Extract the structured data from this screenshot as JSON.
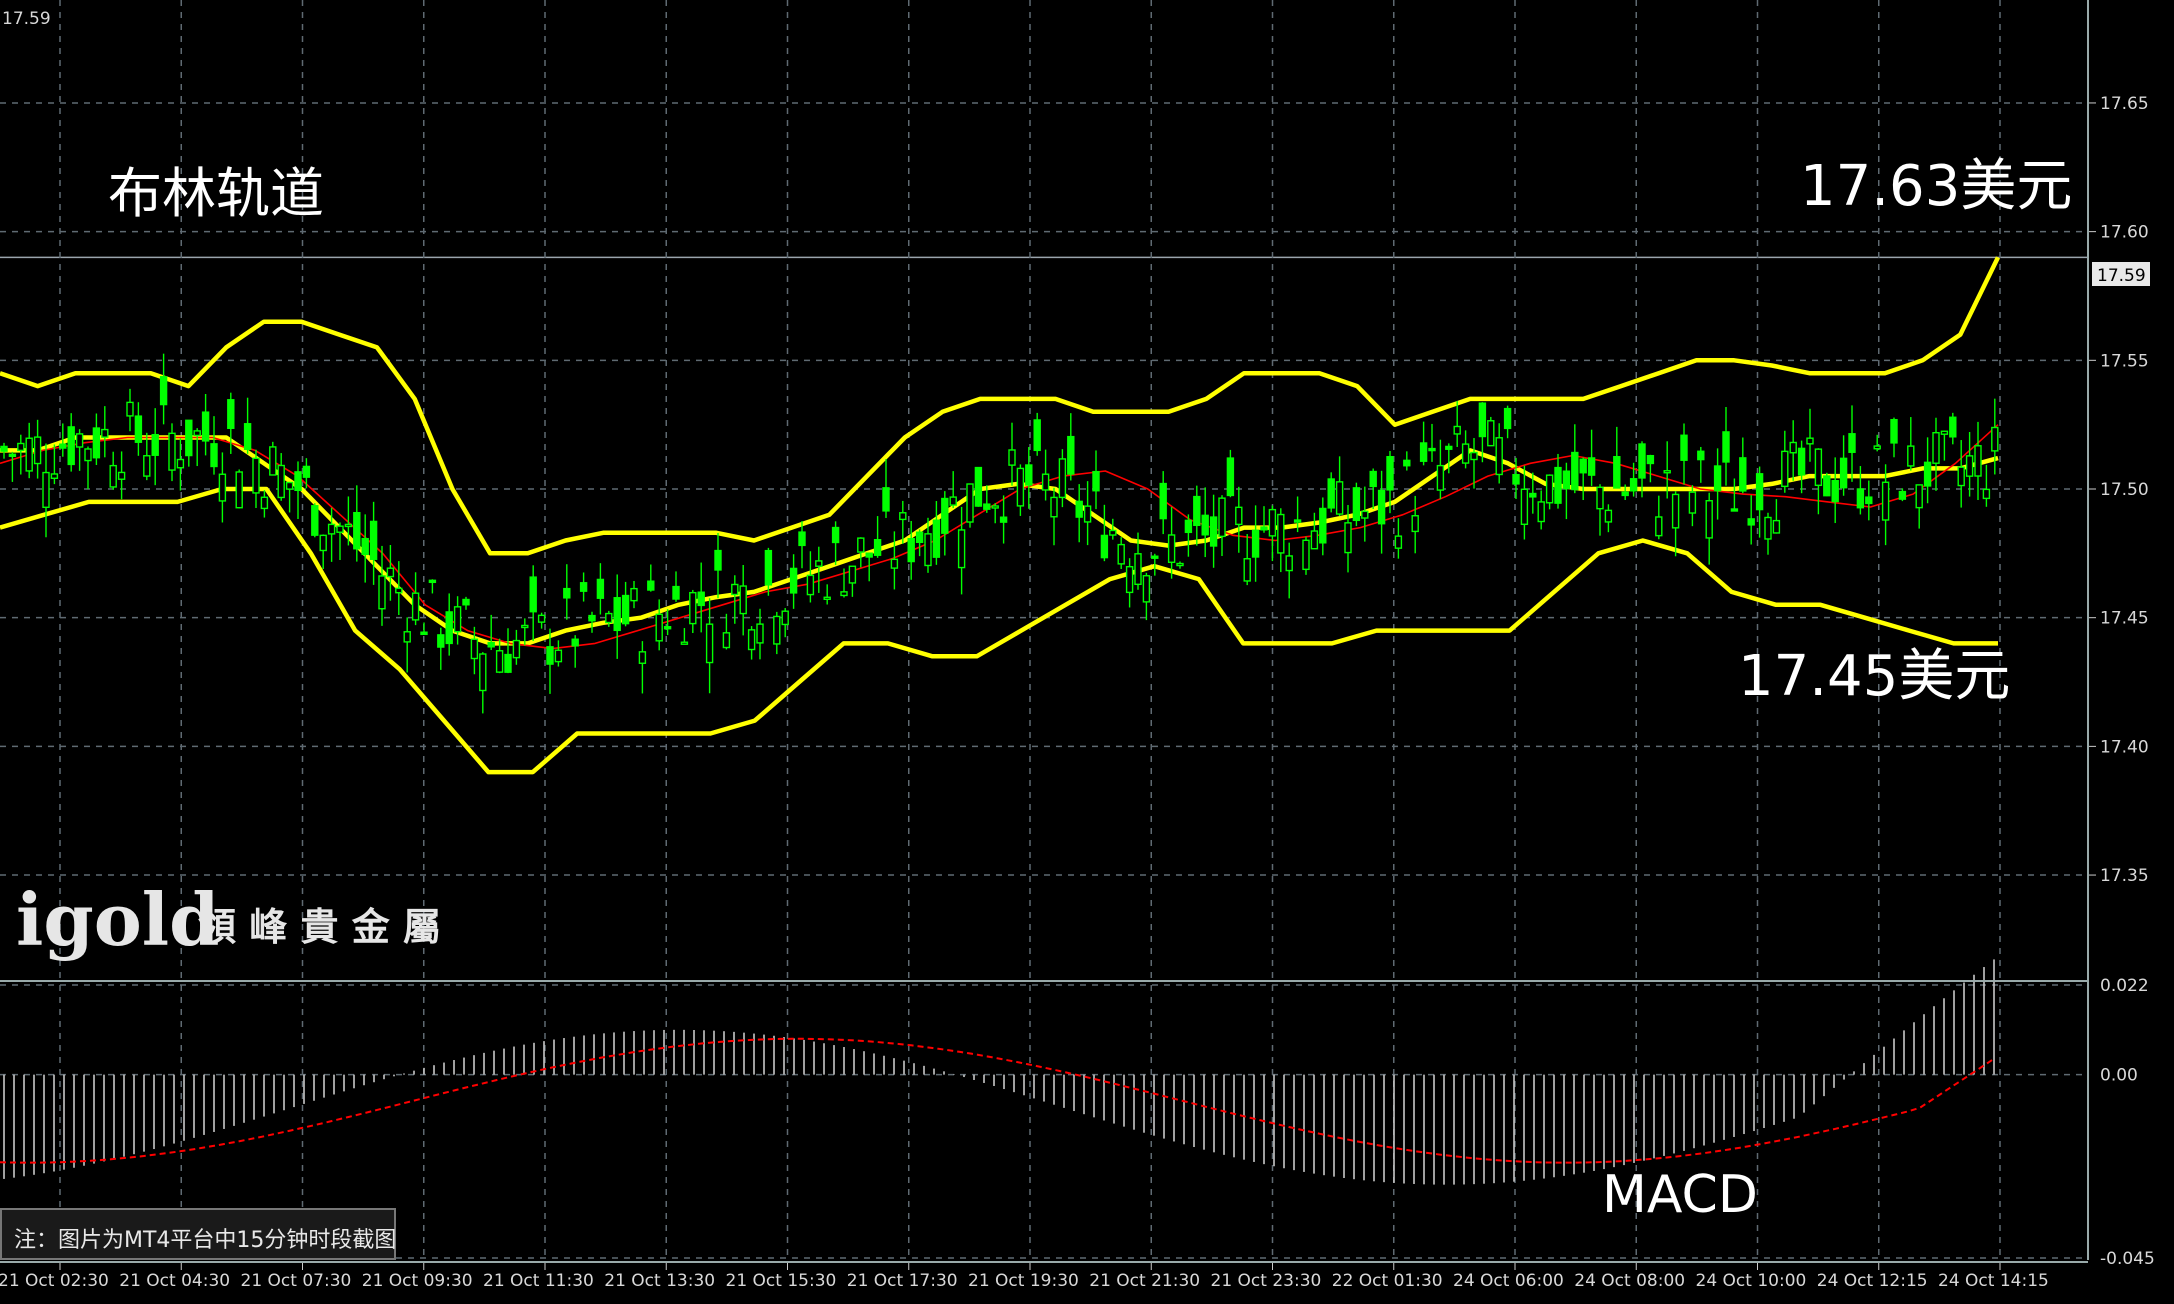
{
  "top_left_price": "17.59",
  "annotations": {
    "title": "布林轨道",
    "upper_target": "17.63美元",
    "lower_target": "17.45美元",
    "macd_label": "MACD",
    "note": "注：图片为MT4平台中15分钟时段截图"
  },
  "logo": {
    "wordmark": "igold",
    "chinese": "領 峰 貴 金 屬"
  },
  "colors": {
    "background": "#000000",
    "grid": "#5f6a72",
    "bollinger": "#ffff00",
    "moving_average": "#ff0000",
    "candle": "#00ff00",
    "macd_histogram": "#c8c8c8",
    "macd_signal": "#ff0000"
  },
  "chart_data": {
    "type": "candlestick",
    "symbol_price_axis_ticks": [
      17.65,
      17.6,
      17.55,
      17.5,
      17.45,
      17.4,
      17.35
    ],
    "current_price": 17.59,
    "current_price_label": "17.59",
    "x_tick_labels": [
      "21 Oct 02:30",
      "21 Oct 04:30",
      "21 Oct 07:30",
      "21 Oct 09:30",
      "21 Oct 11:30",
      "21 Oct 13:30",
      "21 Oct 15:30",
      "21 Oct 17:30",
      "21 Oct 19:30",
      "21 Oct 21:30",
      "21 Oct 23:30",
      "22 Oct 01:30",
      "24 Oct 06:00",
      "24 Oct 08:00",
      "24 Oct 10:00",
      "24 Oct 12:15",
      "24 Oct 14:15"
    ],
    "bollinger_upper": [
      17.545,
      17.54,
      17.545,
      17.545,
      17.545,
      17.54,
      17.555,
      17.565,
      17.565,
      17.56,
      17.555,
      17.535,
      17.5,
      17.475,
      17.475,
      17.48,
      17.483,
      17.483,
      17.483,
      17.483,
      17.48,
      17.485,
      17.49,
      17.505,
      17.52,
      17.53,
      17.535,
      17.535,
      17.535,
      17.53,
      17.53,
      17.53,
      17.535,
      17.545,
      17.545,
      17.545,
      17.54,
      17.525,
      17.53,
      17.535,
      17.535,
      17.535,
      17.535,
      17.54,
      17.545,
      17.55,
      17.55,
      17.548,
      17.545,
      17.545,
      17.545,
      17.55,
      17.56,
      17.59
    ],
    "bollinger_middle": [
      17.515,
      17.515,
      17.52,
      17.52,
      17.52,
      17.52,
      17.52,
      17.51,
      17.5,
      17.485,
      17.47,
      17.455,
      17.445,
      17.44,
      17.44,
      17.445,
      17.448,
      17.45,
      17.455,
      17.458,
      17.46,
      17.465,
      17.47,
      17.475,
      17.48,
      17.49,
      17.5,
      17.502,
      17.5,
      17.49,
      17.48,
      17.478,
      17.48,
      17.485,
      17.485,
      17.487,
      17.49,
      17.495,
      17.505,
      17.515,
      17.51,
      17.502,
      17.5,
      17.5,
      17.5,
      17.5,
      17.5,
      17.502,
      17.505,
      17.505,
      17.505,
      17.508,
      17.508,
      17.512
    ],
    "bollinger_lower": [
      17.485,
      17.49,
      17.495,
      17.495,
      17.495,
      17.5,
      17.5,
      17.475,
      17.445,
      17.43,
      17.41,
      17.39,
      17.39,
      17.405,
      17.405,
      17.405,
      17.405,
      17.41,
      17.425,
      17.44,
      17.44,
      17.435,
      17.435,
      17.445,
      17.455,
      17.465,
      17.47,
      17.465,
      17.44,
      17.44,
      17.44,
      17.445,
      17.445,
      17.445,
      17.445,
      17.46,
      17.475,
      17.48,
      17.475,
      17.46,
      17.455,
      17.455,
      17.45,
      17.445,
      17.44,
      17.44
    ],
    "moving_average": [
      17.51,
      17.515,
      17.518,
      17.52,
      17.52,
      17.52,
      17.515,
      17.505,
      17.49,
      17.475,
      17.455,
      17.445,
      17.44,
      17.438,
      17.44,
      17.445,
      17.45,
      17.455,
      17.46,
      17.463,
      17.468,
      17.473,
      17.48,
      17.49,
      17.5,
      17.505,
      17.507,
      17.5,
      17.488,
      17.482,
      17.48,
      17.482,
      17.485,
      17.49,
      17.497,
      17.505,
      17.51,
      17.513,
      17.51,
      17.505,
      17.5,
      17.498,
      17.497,
      17.495,
      17.493,
      17.498,
      17.51,
      17.525
    ],
    "price_range": [
      17.31,
      17.69
    ],
    "macd_axis_ticks": [
      "0.022",
      "0.00",
      "-0.045"
    ],
    "macd_range": [
      -0.045,
      0.022
    ]
  }
}
